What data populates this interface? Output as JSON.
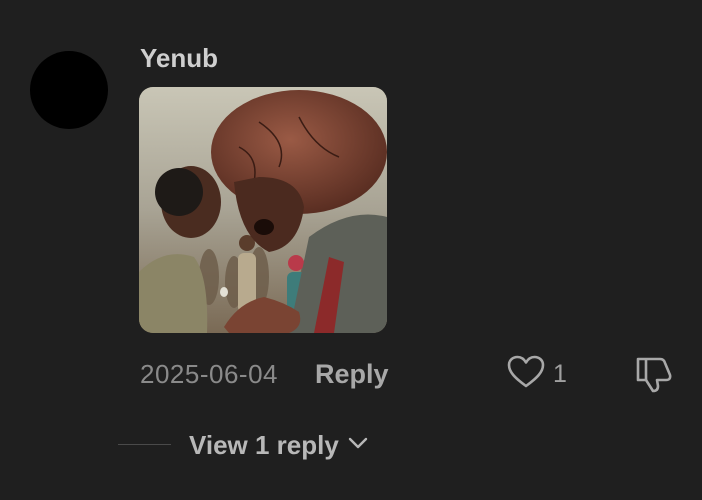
{
  "comment": {
    "author": "Yenub",
    "date": "2025-06-04",
    "reply_label": "Reply",
    "like_count": "1",
    "view_replies_label": "View 1 reply",
    "icons": {
      "like": "heart-icon",
      "dislike": "thumbs-down-icon",
      "expand": "chevron-down-icon"
    }
  },
  "colors": {
    "background": "#1f1f1f",
    "author_text": "#cfcfcf",
    "muted_text": "#8a8a8a"
  }
}
